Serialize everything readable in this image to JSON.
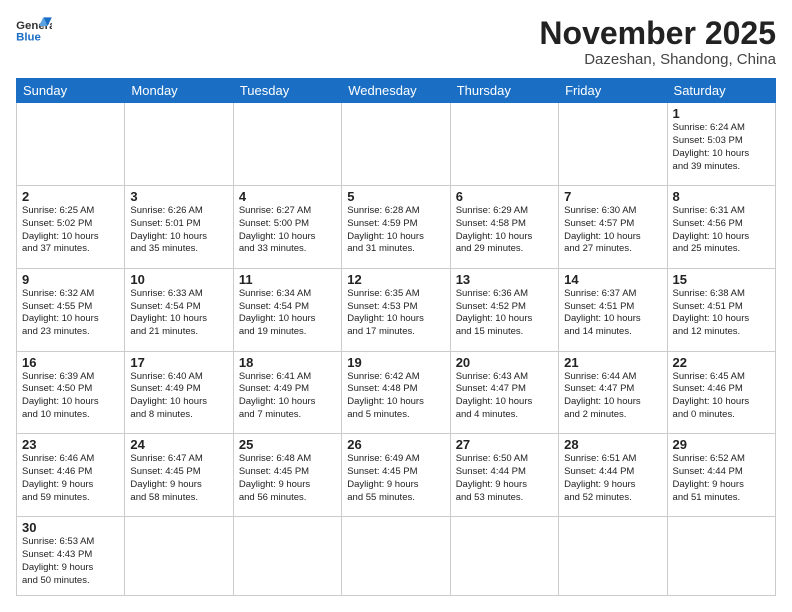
{
  "logo": {
    "line1": "General",
    "line2": "Blue"
  },
  "title": "November 2025",
  "location": "Dazeshan, Shandong, China",
  "weekdays": [
    "Sunday",
    "Monday",
    "Tuesday",
    "Wednesday",
    "Thursday",
    "Friday",
    "Saturday"
  ],
  "weeks": [
    [
      {
        "day": "",
        "info": ""
      },
      {
        "day": "",
        "info": ""
      },
      {
        "day": "",
        "info": ""
      },
      {
        "day": "",
        "info": ""
      },
      {
        "day": "",
        "info": ""
      },
      {
        "day": "",
        "info": ""
      },
      {
        "day": "1",
        "info": "Sunrise: 6:24 AM\nSunset: 5:03 PM\nDaylight: 10 hours\nand 39 minutes."
      }
    ],
    [
      {
        "day": "2",
        "info": "Sunrise: 6:25 AM\nSunset: 5:02 PM\nDaylight: 10 hours\nand 37 minutes."
      },
      {
        "day": "3",
        "info": "Sunrise: 6:26 AM\nSunset: 5:01 PM\nDaylight: 10 hours\nand 35 minutes."
      },
      {
        "day": "4",
        "info": "Sunrise: 6:27 AM\nSunset: 5:00 PM\nDaylight: 10 hours\nand 33 minutes."
      },
      {
        "day": "5",
        "info": "Sunrise: 6:28 AM\nSunset: 4:59 PM\nDaylight: 10 hours\nand 31 minutes."
      },
      {
        "day": "6",
        "info": "Sunrise: 6:29 AM\nSunset: 4:58 PM\nDaylight: 10 hours\nand 29 minutes."
      },
      {
        "day": "7",
        "info": "Sunrise: 6:30 AM\nSunset: 4:57 PM\nDaylight: 10 hours\nand 27 minutes."
      },
      {
        "day": "8",
        "info": "Sunrise: 6:31 AM\nSunset: 4:56 PM\nDaylight: 10 hours\nand 25 minutes."
      }
    ],
    [
      {
        "day": "9",
        "info": "Sunrise: 6:32 AM\nSunset: 4:55 PM\nDaylight: 10 hours\nand 23 minutes."
      },
      {
        "day": "10",
        "info": "Sunrise: 6:33 AM\nSunset: 4:54 PM\nDaylight: 10 hours\nand 21 minutes."
      },
      {
        "day": "11",
        "info": "Sunrise: 6:34 AM\nSunset: 4:54 PM\nDaylight: 10 hours\nand 19 minutes."
      },
      {
        "day": "12",
        "info": "Sunrise: 6:35 AM\nSunset: 4:53 PM\nDaylight: 10 hours\nand 17 minutes."
      },
      {
        "day": "13",
        "info": "Sunrise: 6:36 AM\nSunset: 4:52 PM\nDaylight: 10 hours\nand 15 minutes."
      },
      {
        "day": "14",
        "info": "Sunrise: 6:37 AM\nSunset: 4:51 PM\nDaylight: 10 hours\nand 14 minutes."
      },
      {
        "day": "15",
        "info": "Sunrise: 6:38 AM\nSunset: 4:51 PM\nDaylight: 10 hours\nand 12 minutes."
      }
    ],
    [
      {
        "day": "16",
        "info": "Sunrise: 6:39 AM\nSunset: 4:50 PM\nDaylight: 10 hours\nand 10 minutes."
      },
      {
        "day": "17",
        "info": "Sunrise: 6:40 AM\nSunset: 4:49 PM\nDaylight: 10 hours\nand 8 minutes."
      },
      {
        "day": "18",
        "info": "Sunrise: 6:41 AM\nSunset: 4:49 PM\nDaylight: 10 hours\nand 7 minutes."
      },
      {
        "day": "19",
        "info": "Sunrise: 6:42 AM\nSunset: 4:48 PM\nDaylight: 10 hours\nand 5 minutes."
      },
      {
        "day": "20",
        "info": "Sunrise: 6:43 AM\nSunset: 4:47 PM\nDaylight: 10 hours\nand 4 minutes."
      },
      {
        "day": "21",
        "info": "Sunrise: 6:44 AM\nSunset: 4:47 PM\nDaylight: 10 hours\nand 2 minutes."
      },
      {
        "day": "22",
        "info": "Sunrise: 6:45 AM\nSunset: 4:46 PM\nDaylight: 10 hours\nand 0 minutes."
      }
    ],
    [
      {
        "day": "23",
        "info": "Sunrise: 6:46 AM\nSunset: 4:46 PM\nDaylight: 9 hours\nand 59 minutes."
      },
      {
        "day": "24",
        "info": "Sunrise: 6:47 AM\nSunset: 4:45 PM\nDaylight: 9 hours\nand 58 minutes."
      },
      {
        "day": "25",
        "info": "Sunrise: 6:48 AM\nSunset: 4:45 PM\nDaylight: 9 hours\nand 56 minutes."
      },
      {
        "day": "26",
        "info": "Sunrise: 6:49 AM\nSunset: 4:45 PM\nDaylight: 9 hours\nand 55 minutes."
      },
      {
        "day": "27",
        "info": "Sunrise: 6:50 AM\nSunset: 4:44 PM\nDaylight: 9 hours\nand 53 minutes."
      },
      {
        "day": "28",
        "info": "Sunrise: 6:51 AM\nSunset: 4:44 PM\nDaylight: 9 hours\nand 52 minutes."
      },
      {
        "day": "29",
        "info": "Sunrise: 6:52 AM\nSunset: 4:44 PM\nDaylight: 9 hours\nand 51 minutes."
      }
    ],
    [
      {
        "day": "30",
        "info": "Sunrise: 6:53 AM\nSunset: 4:43 PM\nDaylight: 9 hours\nand 50 minutes."
      },
      {
        "day": "",
        "info": ""
      },
      {
        "day": "",
        "info": ""
      },
      {
        "day": "",
        "info": ""
      },
      {
        "day": "",
        "info": ""
      },
      {
        "day": "",
        "info": ""
      },
      {
        "day": "",
        "info": ""
      }
    ]
  ]
}
